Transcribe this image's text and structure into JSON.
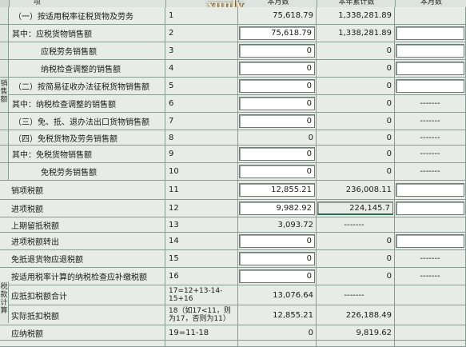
{
  "header": {
    "col_label_stub": "项",
    "col_curr_month": "本月数",
    "col_year_total": "本年累计数",
    "col_curr_month_2": "本月数"
  },
  "watermark": "xunlv",
  "side_labels": {
    "sales": "销售额",
    "tax": "税款计算"
  },
  "rows": [
    {
      "label": "（一）按适用税率征税货物及劳务",
      "num": "1",
      "v1": "75,618.79",
      "v2": "1,338,281.89",
      "v3": ""
    },
    {
      "label": "其中：应税货物销售额",
      "num": "2",
      "v1": "75,618.79",
      "v2": "1,338,281.89",
      "v3": ""
    },
    {
      "label": "应税劳务销售额",
      "num": "3",
      "v1": "0",
      "v2": "0",
      "v3": ""
    },
    {
      "label": "纳税检查调整的销售额",
      "num": "4",
      "v1": "0",
      "v2": "0",
      "v3": ""
    },
    {
      "label": "（二）按简易征收办法征税货物销售额",
      "num": "5",
      "v1": "0",
      "v2": "0",
      "v3": ""
    },
    {
      "label": "其中：纳税检查调整的销售额",
      "num": "6",
      "v1": "0",
      "v2": "0",
      "v3": "-------"
    },
    {
      "label": "（三）免、抵、退办法出口货物销售额",
      "num": "7",
      "v1": "0",
      "v2": "0",
      "v3": "-------"
    },
    {
      "label": "（四）免税货物及劳务销售额",
      "num": "8",
      "v1": "0",
      "v2": "0",
      "v3": "-------"
    },
    {
      "label": "其中：免税货物销售额",
      "num": "9",
      "v1": "0",
      "v2": "0",
      "v3": "-------"
    },
    {
      "label": "免税劳务销售额",
      "num": "10",
      "v1": "0",
      "v2": "0",
      "v3": "-------"
    },
    {
      "label": "销项税额",
      "num": "11",
      "v1": "12,855.21",
      "v2": "236,008.11",
      "v3": ""
    },
    {
      "label": "进项税额",
      "num": "12",
      "v1": "9,982.92",
      "v2": "224,145.7",
      "v3": ""
    },
    {
      "label": "上期留抵税额",
      "num": "13",
      "v1": "3,093.72",
      "v2": "-------",
      "v3": ""
    },
    {
      "label": "进项税额转出",
      "num": "14",
      "v1": "0",
      "v2": "0",
      "v3": ""
    },
    {
      "label": "免抵退货物应退税额",
      "num": "15",
      "v1": "0",
      "v2": "0",
      "v3": "-------"
    },
    {
      "label": "按适用税率计算的纳税检查应补缴税额",
      "num": "16",
      "v1": "0",
      "v2": "0",
      "v3": "-------"
    },
    {
      "label": "应抵扣税额合计",
      "num": "17=12+13-14-15+16",
      "v1": "13,076.64",
      "v2": "-------",
      "v3": ""
    },
    {
      "label": "实际抵扣税额",
      "num": "18（如17<11，则为17，否则为11）",
      "v1": "12,855.21",
      "v2": "226,188.49",
      "v3": ""
    },
    {
      "label": "应纳税额",
      "num": "19=11-18",
      "v1": "0",
      "v2": "9,819.62",
      "v3": ""
    }
  ]
}
